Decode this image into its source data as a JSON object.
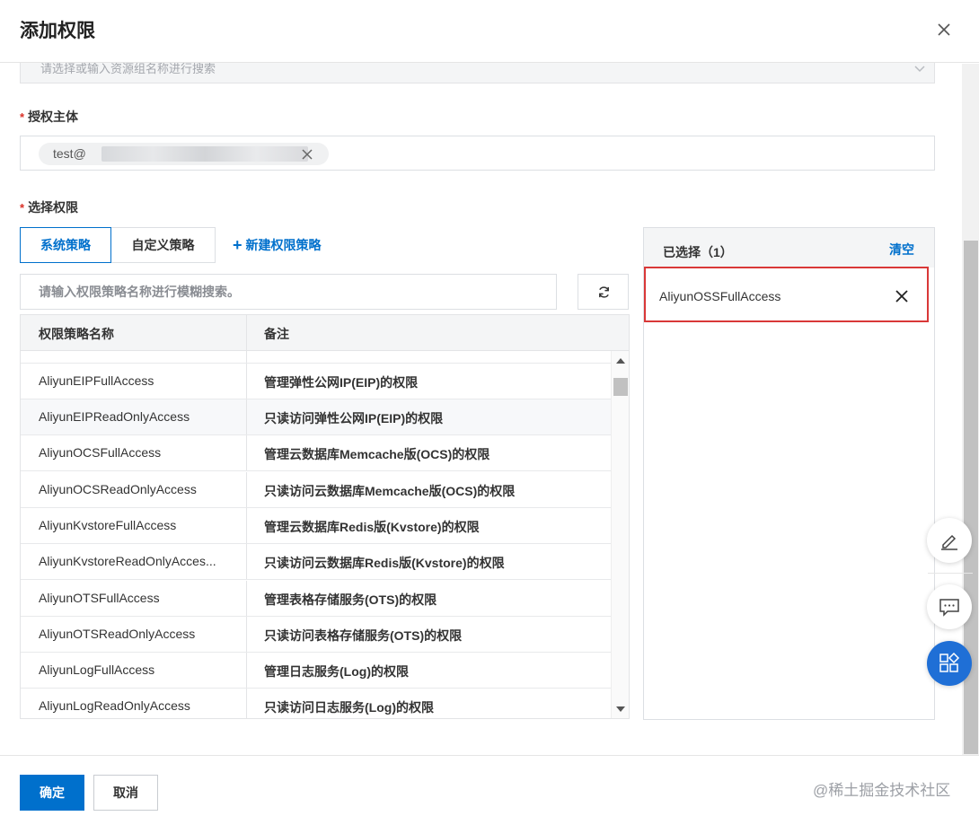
{
  "dialog": {
    "title": "添加权限",
    "close_icon": "close-icon"
  },
  "resource_group": {
    "placeholder": "请选择或输入资源组名称进行搜索"
  },
  "principal": {
    "label": "授权主体",
    "required_mark": "*",
    "tag_text": "test@"
  },
  "permissions": {
    "label": "选择权限",
    "required_mark": "*",
    "tabs": [
      {
        "label": "系统策略",
        "active": true
      },
      {
        "label": "自定义策略",
        "active": false
      }
    ],
    "new_policy_plus": "+",
    "new_policy_label": "新建权限策略",
    "search_placeholder": "请输入权限策略名称进行模糊搜索。",
    "refresh_icon": "refresh-icon",
    "columns": [
      "权限策略名称",
      "备注"
    ],
    "rows": [
      {
        "name": "AliyunEIPFullAccess",
        "desc": "管理弹性公网IP(EIP)的权限"
      },
      {
        "name": "AliyunEIPReadOnlyAccess",
        "desc": "只读访问弹性公网IP(EIP)的权限"
      },
      {
        "name": "AliyunOCSFullAccess",
        "desc": "管理云数据库Memcache版(OCS)的权限"
      },
      {
        "name": "AliyunOCSReadOnlyAccess",
        "desc": "只读访问云数据库Memcache版(OCS)的权限"
      },
      {
        "name": "AliyunKvstoreFullAccess",
        "desc": "管理云数据库Redis版(Kvstore)的权限"
      },
      {
        "name": "AliyunKvstoreReadOnlyAcces...",
        "desc": "只读访问云数据库Redis版(Kvstore)的权限"
      },
      {
        "name": "AliyunOTSFullAccess",
        "desc": "管理表格存储服务(OTS)的权限"
      },
      {
        "name": "AliyunOTSReadOnlyAccess",
        "desc": "只读访问表格存储服务(OTS)的权限"
      },
      {
        "name": "AliyunLogFullAccess",
        "desc": "管理日志服务(Log)的权限"
      },
      {
        "name": "AliyunLogReadOnlyAccess",
        "desc": "只读访问日志服务(Log)的权限"
      }
    ]
  },
  "selected": {
    "title": "已选择（1）",
    "clear_label": "清空",
    "items": [
      "AliyunOSSFullAccess"
    ]
  },
  "footer": {
    "ok_label": "确定",
    "cancel_label": "取消",
    "watermark": "@稀土掘金技术社区"
  },
  "colors": {
    "primary": "#0070cc",
    "highlight_border": "#d93838",
    "float_blue": "#1f6fd6"
  }
}
